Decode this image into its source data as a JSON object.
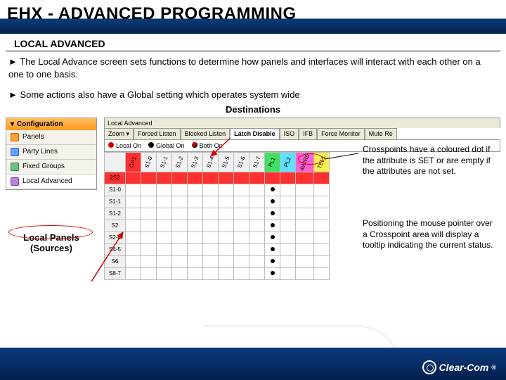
{
  "title": "EHX - ADVANCED PROGRAMMING",
  "subhead": "LOCAL ADVANCED",
  "bullets": [
    "The Local Advance screen sets functions to determine how panels and interfaces will interact with each other on a one to one basis.",
    "Some actions also have a Global setting which operates system wide"
  ],
  "dest_label": "Destinations",
  "sources_label": "Local Panels\n(Sources)",
  "config": {
    "header": "Configuration",
    "items": [
      "Panels",
      "Party Lines",
      "Fixed Groups",
      "Local Advanced"
    ]
  },
  "panel_title": "Local Advanced",
  "tabs": [
    "Zoom ▾",
    "Forced Listen",
    "Blocked Listen",
    "Latch Disable",
    "ISO",
    "IFB",
    "Force Monitor",
    "Mute Re"
  ],
  "active_tab": "Latch Disable",
  "legend": [
    "Local On",
    "Global On",
    "Both On"
  ],
  "col_headers": [
    {
      "t": "GP1",
      "c": "c-red"
    },
    {
      "t": "S1-0",
      "c": ""
    },
    {
      "t": "S1-1",
      "c": ""
    },
    {
      "t": "S1-2",
      "c": ""
    },
    {
      "t": "S1-3",
      "c": ""
    },
    {
      "t": "S1-4",
      "c": ""
    },
    {
      "t": "S1-5",
      "c": ""
    },
    {
      "t": "S1-6",
      "c": ""
    },
    {
      "t": "S1-7",
      "c": ""
    },
    {
      "t": "PL1",
      "c": "c-grn"
    },
    {
      "t": "PL2",
      "c": "c-cyn"
    },
    {
      "t": "4WIRE",
      "c": "c-mag"
    },
    {
      "t": "TEL1",
      "c": "c-yel"
    }
  ],
  "row_headers": [
    "2S2",
    "S1-0",
    "S1-1",
    "S1-2",
    "S2",
    "S2-4",
    "S4-5",
    "S6",
    "S8-7"
  ],
  "dot_col_index": 9,
  "annotations": [
    "Crosspoints have a coloured dot if the attribute is SET or are empty if the attributes are not set.",
    "Positioning the mouse pointer over a Crosspoint area will display a tooltip indicating the current status."
  ],
  "brand": "Clear-Com",
  "reg": "®"
}
